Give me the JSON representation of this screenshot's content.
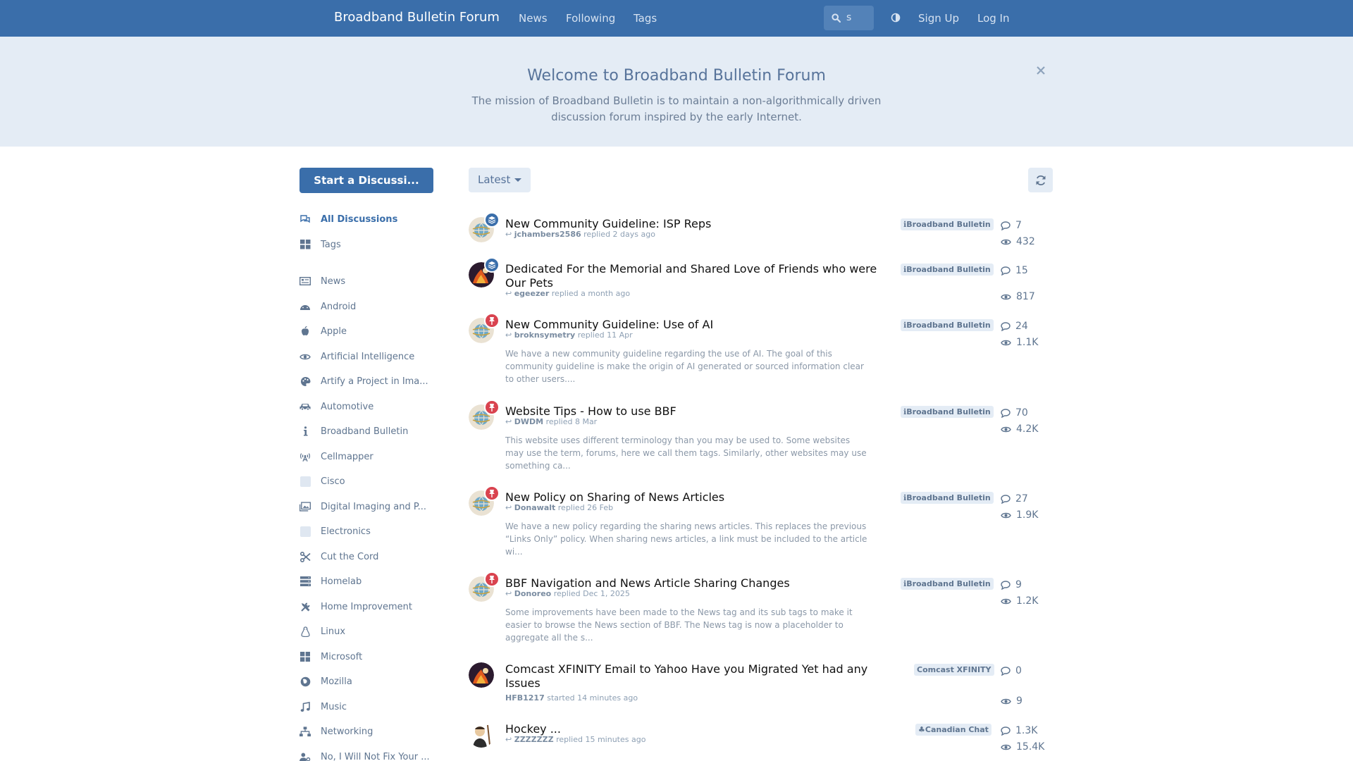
{
  "header": {
    "forum_title": "Broadband Bulletin Forum",
    "nav": [
      "News",
      "Following",
      "Tags"
    ],
    "search_value": "s",
    "sign_up": "Sign Up",
    "log_in": "Log In",
    "bg_color": "#3a6eaa"
  },
  "hero": {
    "title": "Welcome to Broadband Bulletin Forum",
    "text": "The mission of Broadband Bulletin is to maintain a non-algorithmically driven discussion forum inspired by the early Internet.",
    "close_icon": "close-icon"
  },
  "sidebar": {
    "start_button": "Start a Discussi...",
    "items": [
      {
        "label": "All Discussions",
        "icon": "chat-bubbles-icon",
        "active": true
      },
      {
        "label": "Tags",
        "icon": "tags-grid-icon"
      },
      {
        "label": "News",
        "icon": "newspaper-icon"
      },
      {
        "label": "Android",
        "icon": "android-icon"
      },
      {
        "label": "Apple",
        "icon": "apple-icon"
      },
      {
        "label": "Artificial Intelligence",
        "icon": "eye-icon"
      },
      {
        "label": "Artify a Project in Ima...",
        "icon": "palette-icon"
      },
      {
        "label": "Automotive",
        "icon": "car-icon"
      },
      {
        "label": "Broadband Bulletin",
        "icon": "info-icon"
      },
      {
        "label": "Cellmapper",
        "icon": "tower-icon"
      },
      {
        "label": "Cisco",
        "icon": "blank-square-icon"
      },
      {
        "label": "Digital Imaging and P...",
        "icon": "images-icon"
      },
      {
        "label": "Electronics",
        "icon": "blank-square-icon"
      },
      {
        "label": "Cut the Cord",
        "icon": "scissors-icon"
      },
      {
        "label": "Homelab",
        "icon": "server-icon"
      },
      {
        "label": "Home Improvement",
        "icon": "tools-icon"
      },
      {
        "label": "Linux",
        "icon": "linux-icon"
      },
      {
        "label": "Microsoft",
        "icon": "windows-icon"
      },
      {
        "label": "Mozilla",
        "icon": "firefox-icon"
      },
      {
        "label": "Music",
        "icon": "music-icon"
      },
      {
        "label": "Networking",
        "icon": "network-icon"
      },
      {
        "label": "No, I Will Not Fix Your ...",
        "icon": "user-gear-icon"
      }
    ]
  },
  "toolbar": {
    "sort_label": "Latest",
    "refresh_icon": "refresh-icon"
  },
  "discussions": [
    {
      "title": "New Community Guideline: ISP Reps",
      "user": "jchambers2586",
      "action": "replied 2 days ago",
      "excerpt": "",
      "tag": "Broadband Bulletin",
      "replies": "7",
      "views": "432",
      "badge": "layers",
      "avatar": "globe"
    },
    {
      "title": "Dedicated For the Memorial and Shared Love of Friends who were Our Pets",
      "user": "egeezer",
      "action": "replied a month ago",
      "excerpt": "",
      "tag": "Broadband Bulletin",
      "replies": "15",
      "views": "817",
      "badge": "layers",
      "avatar": "fire"
    },
    {
      "title": "New Community Guideline: Use of AI",
      "user": "broknsymetry",
      "action": "replied 11 Apr",
      "excerpt": "We have a new community guideline regarding the use of AI. The goal of this community guideline is make the origin of AI generated or sourced information clear to other users....",
      "tag": "Broadband Bulletin",
      "replies": "24",
      "views": "1.1K",
      "badge": "pin",
      "avatar": "globe"
    },
    {
      "title": "Website Tips - How to use BBF",
      "user": "DWDM",
      "action": "replied 8 Mar",
      "excerpt": "This website uses different terminology than you may be used to. Some websites may use the term, forums, here we call them tags. Similarly, other websites may use something ca...",
      "tag": "Broadband Bulletin",
      "replies": "70",
      "views": "4.2K",
      "badge": "pin",
      "avatar": "globe"
    },
    {
      "title": "New Policy on Sharing of News Articles",
      "user": "Donawalt",
      "action": "replied 26 Feb",
      "excerpt": "We have a new policy regarding the sharing news articles. This replaces the previous “Links Only” policy. When sharing news articles, a link must be included to the article wi...",
      "tag": "Broadband Bulletin",
      "replies": "27",
      "views": "1.9K",
      "badge": "pin",
      "avatar": "globe"
    },
    {
      "title": "BBF Navigation and News Article Sharing Changes",
      "user": "Donoreo",
      "action": "replied Dec 1, 2025",
      "excerpt": "Some improvements have been made to the News tag and its sub tags to make it easier to browse the News section of BBF. The News tag is now a placeholder to aggregate all the s...",
      "tag": "Broadband Bulletin",
      "replies": "9",
      "views": "1.2K",
      "badge": "pin",
      "avatar": "globe"
    },
    {
      "title": "Comcast XFINITY Email to Yahoo Have you Migrated Yet had any Issues",
      "user": "HFB1217",
      "action": "started 14 minutes ago",
      "excerpt": "",
      "tag": "Comcast XFINITY",
      "replies": "0",
      "views": "9",
      "badge": "",
      "avatar": "fire"
    },
    {
      "title": "Hockey ...",
      "user": "ZZZZZZZ",
      "action": "replied 15 minutes ago",
      "excerpt": "",
      "tag": "Canadian Chat",
      "replies": "1.3K",
      "views": "15.4K",
      "badge": "",
      "avatar": "hockey"
    }
  ]
}
